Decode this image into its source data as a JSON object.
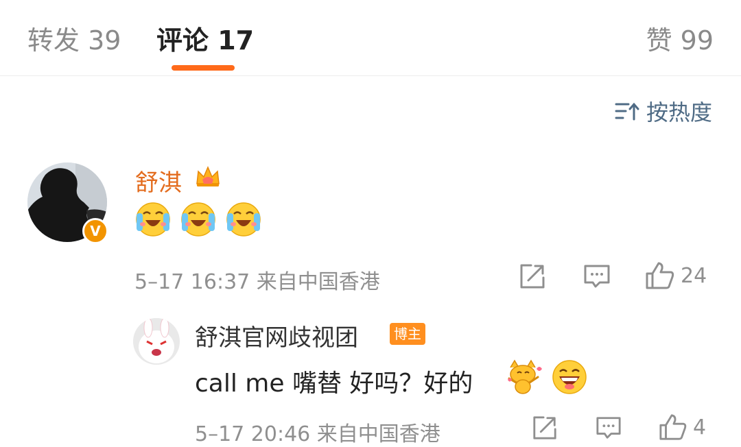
{
  "tabs": {
    "repost": "转发 39",
    "comments": "评论 17",
    "likes": "赞 99"
  },
  "sort": {
    "label": "按热度",
    "icon": "sort-icon"
  },
  "comment": {
    "author": "舒淇",
    "verified_badge": "V",
    "emojis": [
      "laugh-cry-emoji",
      "laugh-cry-emoji",
      "laugh-cry-emoji"
    ],
    "meta": "5–17 16:37 来自中国香港",
    "like_count": "24"
  },
  "reply": {
    "author": "舒淇官网歧视团",
    "author_badge": "博主",
    "text": "call me 嘴替 好吗？好的",
    "meta": "5–17 20:46 来自中国香港",
    "like_count": "4"
  },
  "colors": {
    "accent": "#ff6a1a",
    "author_name": "#e36c1e",
    "sort_text": "#4f6b85",
    "meta_text": "#8f8f8f",
    "badge_orange": "#ff8f1f"
  }
}
